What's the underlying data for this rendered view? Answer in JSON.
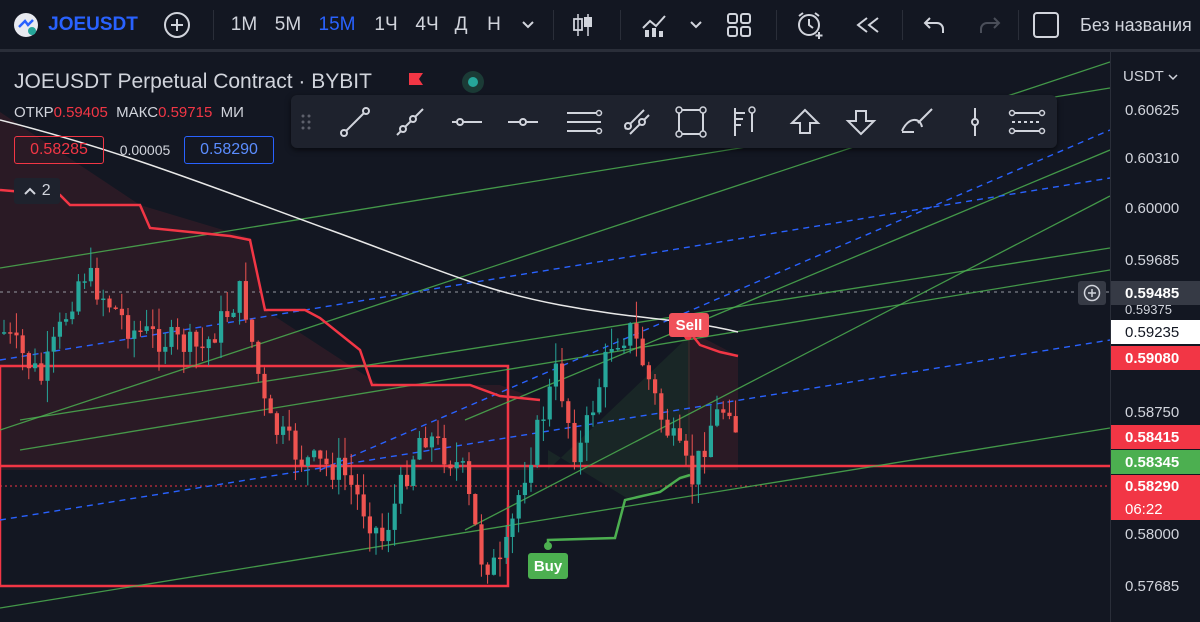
{
  "toolbar": {
    "symbol": "JOEUSDT",
    "timeframes": [
      "1M",
      "5M",
      "15M",
      "1Ч",
      "4Ч",
      "Д",
      "Н"
    ],
    "active_timeframe": "15M",
    "layout_name": "Без названия"
  },
  "legend": {
    "title": "JOEUSDT Perpetual Contract · BYBIT",
    "open_label": "ОТКР",
    "open_value": "0.59405",
    "high_label": "МАКС",
    "high_value": "0.59715",
    "low_label_partial": "МИ",
    "bid": "0.58285",
    "spread": "0.00005",
    "ask": "0.58290",
    "indicator_count": "2"
  },
  "price_axis": {
    "currency": "USDT",
    "ticks": [
      "0.60625",
      "0.60310",
      "0.60000",
      "0.59685",
      "0.59375",
      "0.58750",
      "0.58000",
      "0.57685"
    ],
    "crosshair_price": "0.59485",
    "labels": {
      "white_line": "0.59235",
      "red_upper": "0.59080",
      "red_level": "0.58415",
      "green_level": "0.58345",
      "last_price": "0.58290",
      "countdown": "06:22"
    }
  },
  "signals": {
    "buy": "Buy",
    "sell": "Sell"
  },
  "colors": {
    "up": "#26a69a",
    "down": "#ef5350",
    "accent": "#2962ff",
    "supertrend_up": "#4caf50",
    "supertrend_down": "#f23645"
  },
  "icons": [
    "logo-icon",
    "add-symbol-icon",
    "chevron-down-icon",
    "candles-icon",
    "indicators-icon",
    "templates-icon",
    "alert-icon",
    "replay-icon",
    "undo-icon",
    "redo-icon",
    "layout-checkbox-icon",
    "trendline-icon",
    "ray-icon",
    "horizontal-line-icon",
    "horizontal-ray-icon",
    "parallel-channel-icon",
    "pitchfork-icon",
    "rectangle-icon",
    "fib-icon",
    "arrow-up-icon",
    "arrow-down-icon",
    "brush-icon",
    "vertical-line-icon",
    "more-tools-icon"
  ]
}
